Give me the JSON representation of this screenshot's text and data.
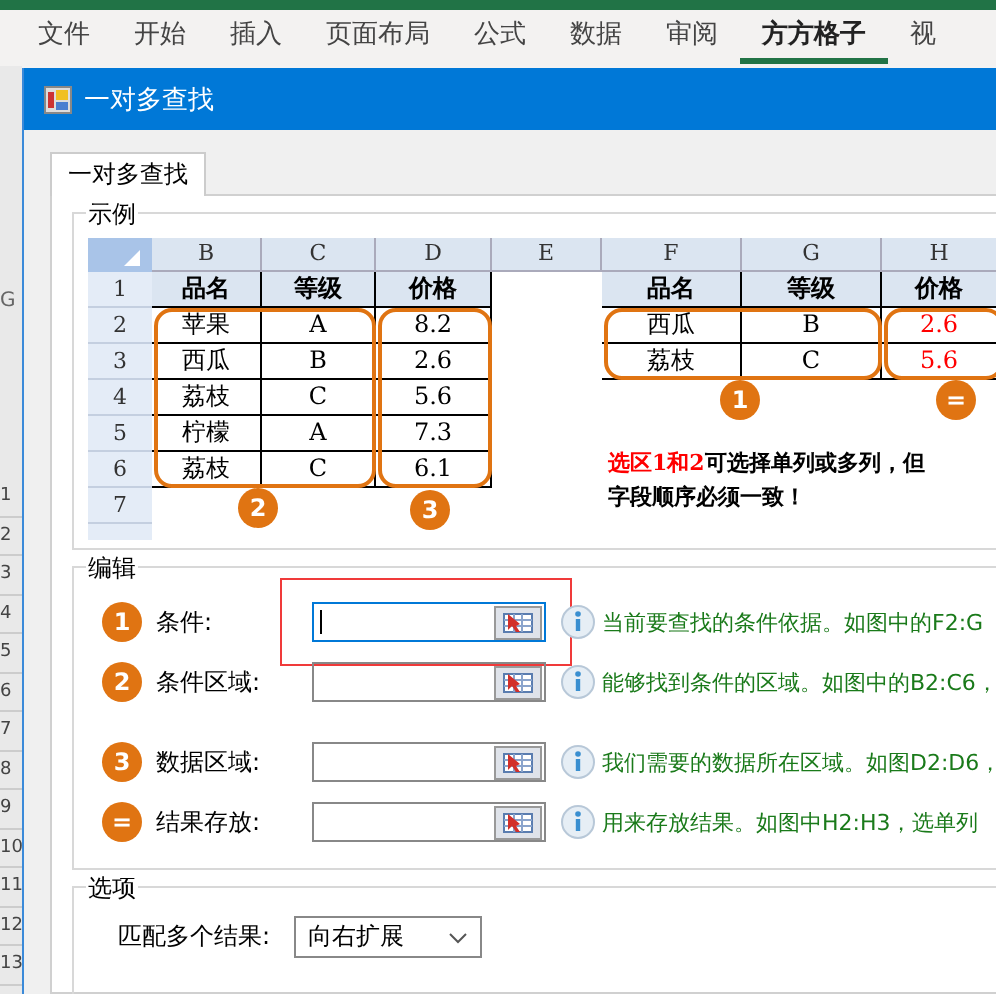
{
  "ribbon_tabs": [
    {
      "label": "文件",
      "selected": false
    },
    {
      "label": "开始",
      "selected": false
    },
    {
      "label": "插入",
      "selected": false
    },
    {
      "label": "页面布局",
      "selected": false
    },
    {
      "label": "公式",
      "selected": false
    },
    {
      "label": "数据",
      "selected": false
    },
    {
      "label": "审阅",
      "selected": false
    },
    {
      "label": "方方格子",
      "selected": true
    },
    {
      "label": "视",
      "selected": false
    }
  ],
  "sheet_behind": {
    "column_header": "G",
    "row_numbers": [
      "1",
      "2",
      "3",
      "4",
      "5",
      "6",
      "7",
      "8",
      "9",
      "10",
      "11",
      "12",
      "13"
    ]
  },
  "dialog": {
    "title": "一对多查找",
    "tabs": [
      {
        "label": "一对多查找",
        "selected": true
      }
    ],
    "example": {
      "legend": "示例",
      "column_letters": [
        "B",
        "C",
        "D",
        "E",
        "F",
        "G",
        "H"
      ],
      "row_numbers": [
        "1",
        "2",
        "3",
        "4",
        "5",
        "6",
        "7"
      ],
      "left_table": {
        "headers": [
          "品名",
          "等级",
          "价格"
        ],
        "rows": [
          [
            "苹果",
            "A",
            "8.2"
          ],
          [
            "西瓜",
            "B",
            "2.6"
          ],
          [
            "荔枝",
            "C",
            "5.6"
          ],
          [
            "柠檬",
            "A",
            "7.3"
          ],
          [
            "荔枝",
            "C",
            "6.1"
          ]
        ]
      },
      "right_table": {
        "headers": [
          "品名",
          "等级",
          "价格"
        ],
        "rows": [
          [
            "西瓜",
            "B",
            "2.6"
          ],
          [
            "荔枝",
            "C",
            "5.6"
          ]
        ]
      },
      "regions": [
        {
          "marker": "2"
        },
        {
          "marker": "3"
        },
        {
          "marker": "1"
        },
        {
          "marker": "="
        }
      ],
      "note": {
        "highlight": "选区1和2",
        "line_1": "可选择单列或多列，但",
        "line_2": "字段顺序必须一致！"
      }
    },
    "edit": {
      "legend": "编辑",
      "fields": [
        {
          "marker": "1",
          "label": "条件:",
          "focused": true,
          "highlighted": true,
          "hint": "当前要查找的条件依据。如图中的F2:G"
        },
        {
          "marker": "2",
          "label": "条件区域:",
          "focused": false,
          "highlighted": false,
          "hint": "能够找到条件的区域。如图中的B2:C6，"
        },
        {
          "marker": "3",
          "label": "数据区域:",
          "focused": false,
          "highlighted": false,
          "hint": "我们需要的数据所在区域。如图D2:D6，"
        },
        {
          "marker": "=",
          "label": "结果存放:",
          "focused": false,
          "highlighted": false,
          "hint": "用来存放结果。如图中H2:H3，选单列"
        }
      ]
    },
    "options": {
      "legend": "选项",
      "label": "匹配多个结果:",
      "value": "向右扩展"
    }
  }
}
